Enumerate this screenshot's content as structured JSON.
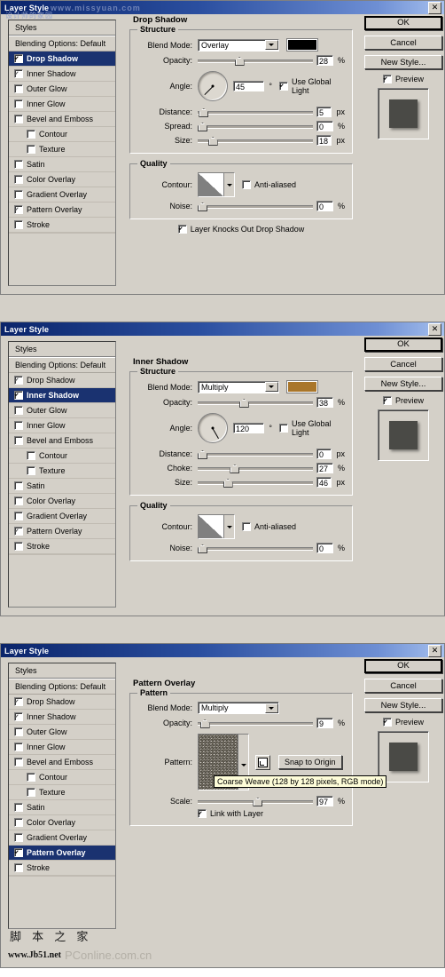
{
  "window": {
    "title": "Layer Style",
    "close_label": "✕"
  },
  "styles_panel": {
    "header": "Styles",
    "blending_options": "Blending Options: Default",
    "items": [
      {
        "label": "Drop Shadow",
        "checked": true,
        "indent": false
      },
      {
        "label": "Inner Shadow",
        "checked": true,
        "indent": false
      },
      {
        "label": "Outer Glow",
        "checked": false,
        "indent": false
      },
      {
        "label": "Inner Glow",
        "checked": false,
        "indent": false
      },
      {
        "label": "Bevel and Emboss",
        "checked": false,
        "indent": false
      },
      {
        "label": "Contour",
        "checked": false,
        "indent": true
      },
      {
        "label": "Texture",
        "checked": false,
        "indent": true
      },
      {
        "label": "Satin",
        "checked": false,
        "indent": false
      },
      {
        "label": "Color Overlay",
        "checked": false,
        "indent": false
      },
      {
        "label": "Gradient Overlay",
        "checked": false,
        "indent": false
      },
      {
        "label": "Pattern Overlay",
        "checked": true,
        "indent": false
      },
      {
        "label": "Stroke",
        "checked": false,
        "indent": false
      }
    ]
  },
  "buttons": {
    "ok": "OK",
    "cancel": "Cancel",
    "new_style": "New Style...",
    "preview": "Preview"
  },
  "labels": {
    "blend_mode": "Blend Mode:",
    "opacity": "Opacity:",
    "angle": "Angle:",
    "distance": "Distance:",
    "spread": "Spread:",
    "choke": "Choke:",
    "size": "Size:",
    "contour": "Contour:",
    "noise": "Noise:",
    "pattern": "Pattern:",
    "scale": "Scale:",
    "quality": "Quality",
    "structure": "Structure",
    "pattern_group": "Pattern",
    "anti_aliased": "Anti-aliased",
    "use_global_light": "Use Global Light",
    "layer_knocks_out": "Layer Knocks Out Drop Shadow",
    "link_with_layer": "Link with Layer",
    "snap_to_origin": "Snap to Origin",
    "unit_percent": "%",
    "unit_px": "px",
    "unit_degree": "°"
  },
  "dialog1": {
    "section_title": "Drop Shadow",
    "blend_mode": "Overlay",
    "color": "#000000",
    "opacity": "28",
    "opacity_pct": 28,
    "angle": "45",
    "angle_deg": 45,
    "use_global_light": true,
    "distance": "5",
    "distance_pct": 5,
    "spread": "0",
    "spread_pct": 0,
    "size": "18",
    "size_pct": 18,
    "anti_aliased": false,
    "noise": "0",
    "noise_pct": 0,
    "layer_knocks_out": true,
    "selected_style": "Drop Shadow"
  },
  "dialog2": {
    "section_title": "Inner Shadow",
    "blend_mode": "Multiply",
    "color": "#a9762a",
    "opacity": "38",
    "opacity_pct": 38,
    "angle": "120",
    "angle_deg": 120,
    "use_global_light": false,
    "distance": "0",
    "distance_pct": 0,
    "choke": "27",
    "choke_pct": 27,
    "size": "46",
    "size_pct": 30,
    "anti_aliased": false,
    "noise": "0",
    "noise_pct": 0,
    "selected_style": "Inner Shadow"
  },
  "dialog3": {
    "section_title": "Pattern Overlay",
    "blend_mode": "Multiply",
    "opacity": "9",
    "opacity_pct": 9,
    "scale": "97",
    "scale_pct": 50,
    "link_with_layer": true,
    "snap_to_origin": "Snap to Origin",
    "pattern_tooltip": "Coarse Weave (128 by 128 pixels, RGB mode)",
    "selected_style": "Pattern Overlay"
  },
  "watermarks": {
    "top_site": "www.missyuan.com",
    "top_cn": "设计师的家园",
    "bottom_cn": "脚 本 之 家",
    "bottom_url": "www.Jb51.net",
    "bottom_pc": "PConline.com.cn"
  }
}
